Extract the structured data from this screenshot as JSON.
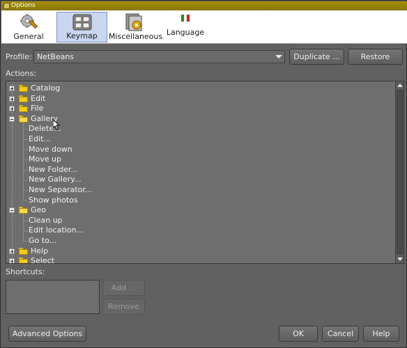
{
  "window": {
    "title": "Options"
  },
  "toolbar": {
    "tabs": [
      {
        "label": "General",
        "icon": "gear-wrench-icon",
        "active": false
      },
      {
        "label": "Keymap",
        "icon": "keyboard-icon",
        "active": true
      },
      {
        "label": "Miscellaneous",
        "icon": "misc-icon",
        "active": false
      },
      {
        "label": "Language",
        "icon": "language-flag-icon",
        "active": false
      }
    ]
  },
  "profile": {
    "label": "Profile:",
    "value": "NetBeans",
    "duplicate_label": "Duplicate ...",
    "restore_label": "Restore"
  },
  "actions": {
    "label": "Actions:",
    "tree": [
      {
        "label": "Catalog",
        "type": "folder",
        "expanded": false
      },
      {
        "label": "Edit",
        "type": "folder",
        "expanded": false
      },
      {
        "label": "File",
        "type": "folder",
        "expanded": false
      },
      {
        "label": "Gallery",
        "type": "folder",
        "expanded": true
      },
      {
        "label": "Delete...",
        "type": "leaf"
      },
      {
        "label": "Edit...",
        "type": "leaf"
      },
      {
        "label": "Move down",
        "type": "leaf"
      },
      {
        "label": "Move up",
        "type": "leaf"
      },
      {
        "label": "New Folder...",
        "type": "leaf"
      },
      {
        "label": "New Gallery...",
        "type": "leaf"
      },
      {
        "label": "New Separator...",
        "type": "leaf"
      },
      {
        "label": "Show photos",
        "type": "leaf"
      },
      {
        "label": "Geo",
        "type": "folder",
        "expanded": true
      },
      {
        "label": "Clean up",
        "type": "leaf"
      },
      {
        "label": "Edit location...",
        "type": "leaf"
      },
      {
        "label": "Go to...",
        "type": "leaf"
      },
      {
        "label": "Help",
        "type": "folder",
        "expanded": false
      },
      {
        "label": "Select",
        "type": "folder",
        "expanded": false
      }
    ]
  },
  "shortcuts": {
    "label": "Shortcuts:",
    "add_label": "Add ...",
    "remove_label": "Remove"
  },
  "footer": {
    "advanced_label": "Advanced Options",
    "ok_label": "OK",
    "cancel_label": "Cancel",
    "help_label": "Help"
  },
  "colors": {
    "titlebar": "#a58e00",
    "background": "#616161",
    "active_tab": "#c8d6f0"
  }
}
